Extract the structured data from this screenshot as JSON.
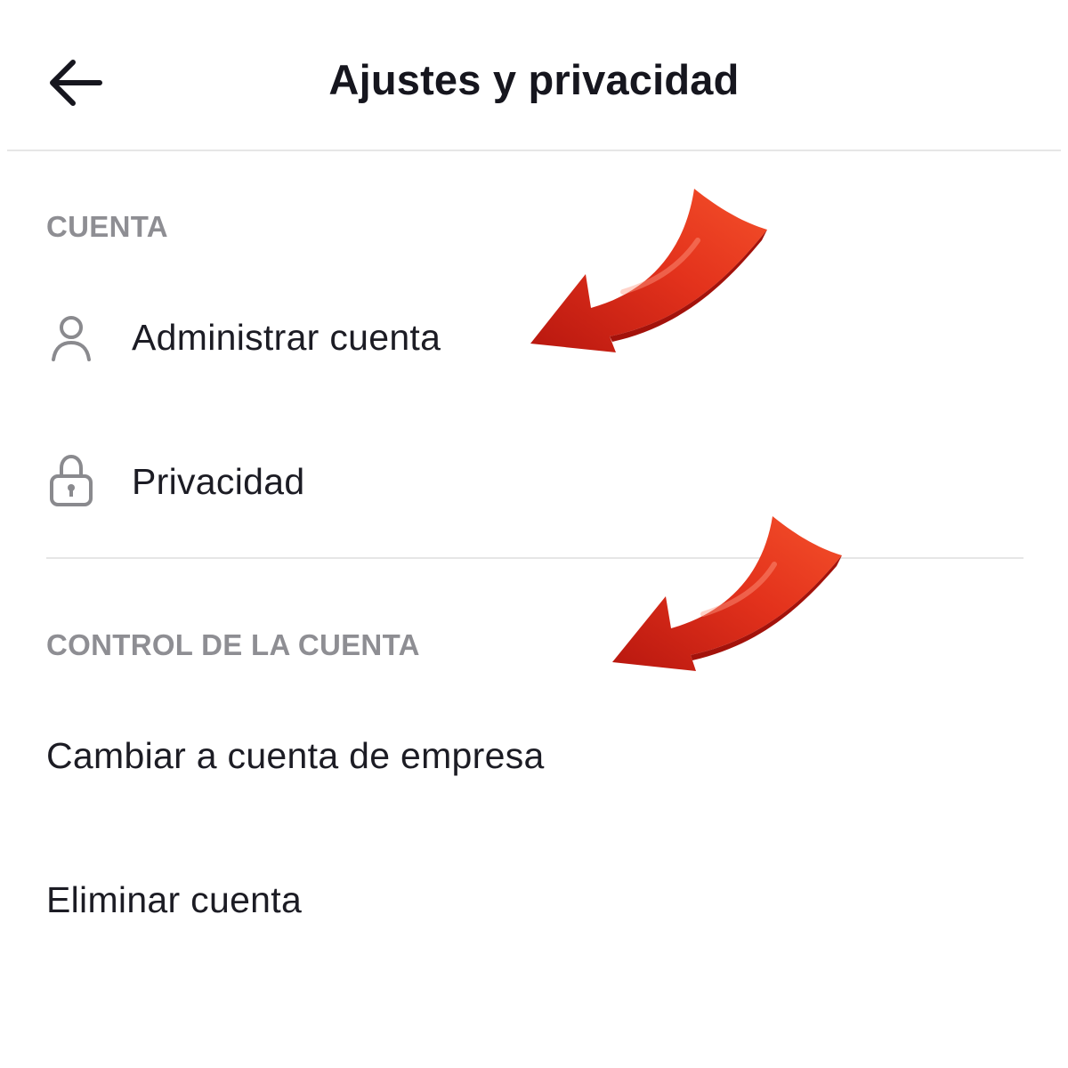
{
  "header": {
    "title": "Ajustes y privacidad",
    "back_icon": "arrow-left-icon"
  },
  "sections": [
    {
      "title": "CUENTA",
      "items": [
        {
          "label": "Administrar cuenta",
          "icon": "person-icon"
        },
        {
          "label": "Privacidad",
          "icon": "lock-icon"
        }
      ]
    },
    {
      "title": "CONTROL DE LA CUENTA",
      "items": [
        {
          "label": "Cambiar a cuenta de empresa"
        },
        {
          "label": "Eliminar cuenta"
        }
      ]
    }
  ],
  "annotations": {
    "arrow_color": "#e5331b",
    "arrow_icon": "red-pointer-arrow-icon"
  },
  "colors": {
    "text": "#1c1c24",
    "section_title": "#8e8e93",
    "icon": "#8a8a8e",
    "divider": "#e6e6e6"
  }
}
